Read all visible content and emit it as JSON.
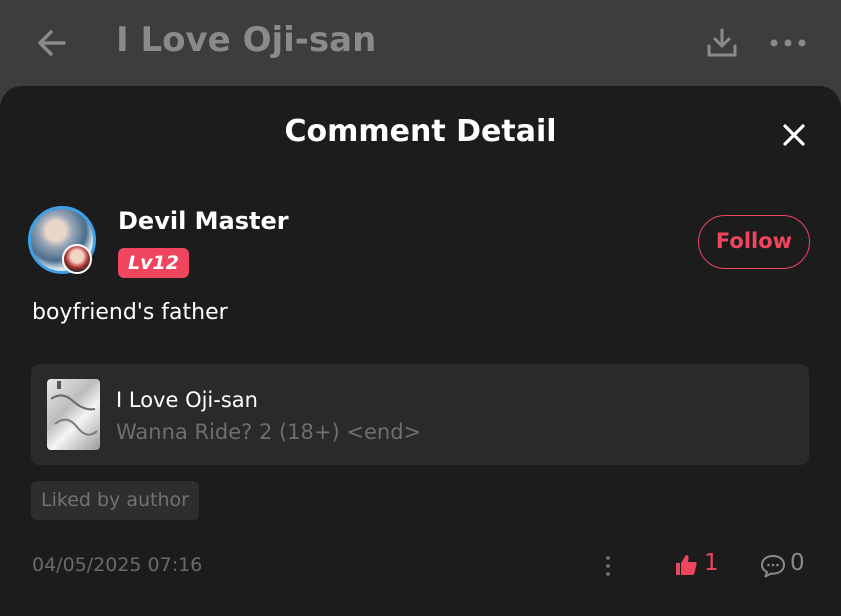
{
  "header": {
    "title": "I Love Oji-san",
    "back_icon": "arrow-left-icon",
    "download_icon": "download-icon",
    "more_icon": "more-horizontal-icon"
  },
  "sheet": {
    "title": "Comment Detail",
    "close_icon": "close-icon"
  },
  "comment": {
    "username": "Devil Master",
    "level": "Lv12",
    "follow_label": "Follow",
    "text": "boyfriend's father",
    "work": {
      "title": "I Love Oji-san",
      "chapter": "Wanna Ride? 2 (18+) <end>"
    },
    "liked_tag": "Liked by author",
    "timestamp": "04/05/2025 07:16",
    "likes": "1",
    "replies": "0"
  },
  "colors": {
    "accent": "#f0455f",
    "sheet_bg": "#1c1c1c",
    "dim_bg": "#3d3d3d",
    "card_bg": "#2a2a2a"
  }
}
